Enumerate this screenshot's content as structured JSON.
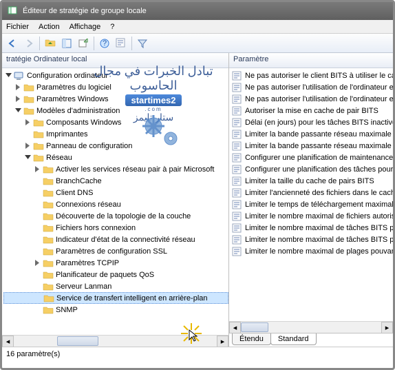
{
  "window": {
    "title": "Éditeur de stratégie de groupe locale"
  },
  "menu": {
    "file": "Fichier",
    "action": "Action",
    "view": "Affichage",
    "help": "?"
  },
  "left_header": "tratégie Ordinateur local",
  "right_header": "Paramètre",
  "tree": {
    "root": "Configuration ordinateur",
    "l1a": "Paramètres du logiciel",
    "l1b": "Paramètres Windows",
    "l1c": "Modèles d'administration",
    "l2a": "Composants Windows",
    "l2b": "Imprimantes",
    "l2c": "Panneau de configuration",
    "l2d": "Réseau",
    "l3a": "Activer les services réseau pair à pair Microsoft",
    "l3b": "BranchCache",
    "l3c": "Client DNS",
    "l3d": "Connexions réseau",
    "l3e": "Découverte de la topologie de la couche",
    "l3f": "Fichiers hors connexion",
    "l3g": "Indicateur d'état de la connectivité réseau",
    "l3h": "Paramètres de configuration SSL",
    "l3i": "Paramètres TCPIP",
    "l3j": "Planificateur de paquets QoS",
    "l3k": "Serveur Lanman",
    "l3l": "Service de transfert intelligent en arrière-plan",
    "l3m": "SNMP"
  },
  "params": [
    "Ne pas autoriser le client BITS à utiliser le cache",
    "Ne pas autoriser l'utilisation de l'ordinateur en",
    "Ne pas autoriser l'utilisation de l'ordinateur en",
    "Autoriser la mise en cache de pair BITS",
    "Délai (en jours) pour les tâches BITS inactives",
    "Limiter la bande passante réseau maximale pour",
    "Limiter la bande passante réseau maximale pour",
    "Configurer une planification de maintenance",
    "Configurer une planification des tâches pour",
    "Limiter la taille du cache de pairs BITS",
    "Limiter l'ancienneté des fichiers dans le cache",
    "Limiter le temps de téléchargement maximal",
    "Limiter le nombre maximal de fichiers autorisés",
    "Limiter le nombre maximal de tâches BITS pour",
    "Limiter le nombre maximal de tâches BITS pour",
    "Limiter le nombre maximal de plages pouvant"
  ],
  "tabs": {
    "extended": "Étendu",
    "standard": "Standard"
  },
  "status": "16 paramètre(s)",
  "watermark": {
    "line1": "تبادل الخبرات في مجال الحاسوب",
    "brand": "startimes2",
    "dotcom": ".com",
    "line2": "ستار تايمز"
  }
}
